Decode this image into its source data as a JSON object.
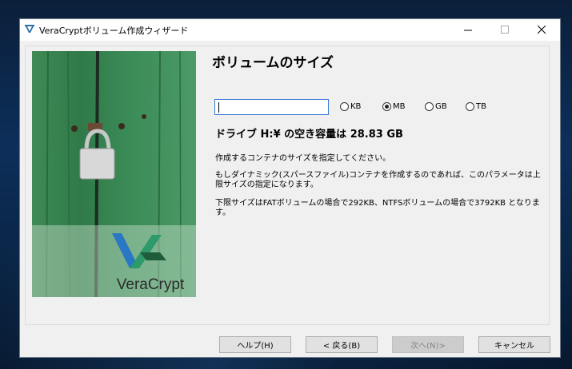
{
  "window": {
    "title": "VeraCryptボリューム作成ウィザード",
    "controls": {
      "minimize": "—",
      "maximize": "☐",
      "close": "✕"
    }
  },
  "side_image": {
    "logo_text": "VeraCrypt"
  },
  "main": {
    "heading": "ボリュームのサイズ",
    "size_input": {
      "value": "",
      "placeholder": ""
    },
    "units": [
      {
        "label": "KB",
        "checked": false
      },
      {
        "label": "MB",
        "checked": true
      },
      {
        "label": "GB",
        "checked": false
      },
      {
        "label": "TB",
        "checked": false
      }
    ],
    "free_space": "ドライブ H:¥ の空き容量は 28.83 GB",
    "text1": "作成するコンテナのサイズを指定してください。",
    "text2": "もしダイナミック(スパースファイル)コンテナを作成するのであれば、このパラメータは上限サイズの指定になります。",
    "text3": "下限サイズはFATボリュームの場合で292KB、NTFSボリュームの場合で3792KB となります。"
  },
  "buttons": {
    "help": "ヘルプ(H)",
    "back": "< 戻る(B)",
    "next": "次へ(N)>",
    "cancel": "キャンセル"
  },
  "colors": {
    "accent": "#3a7bd5",
    "window_bg": "#f0f0f0"
  }
}
